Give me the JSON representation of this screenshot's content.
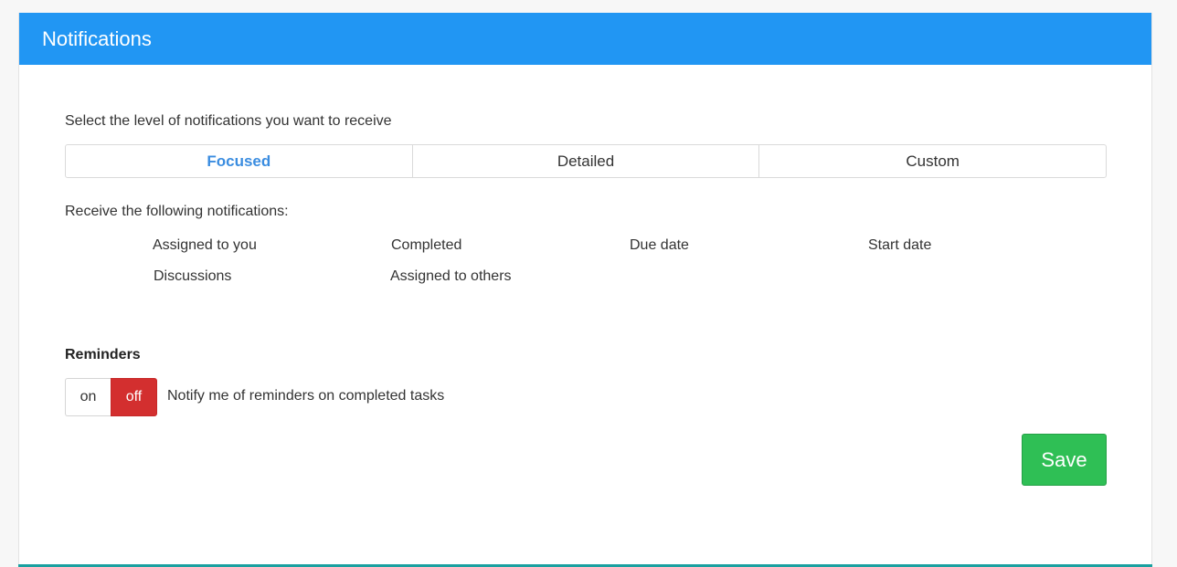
{
  "header": {
    "title": "Notifications"
  },
  "levels": {
    "prompt": "Select the level of notifications you want to receive",
    "options": [
      {
        "label": "Focused",
        "selected": true
      },
      {
        "label": "Detailed",
        "selected": false
      },
      {
        "label": "Custom",
        "selected": false
      }
    ]
  },
  "notifications": {
    "label": "Receive the following notifications:",
    "items": [
      {
        "label": "Assigned to you"
      },
      {
        "label": "Completed"
      },
      {
        "label": "Due date"
      },
      {
        "label": "Start date"
      },
      {
        "label": "Discussions"
      },
      {
        "label": "Assigned to others"
      }
    ]
  },
  "reminders": {
    "title": "Reminders",
    "on_label": "on",
    "off_label": "off",
    "state": "off",
    "description": "Notify me of reminders on completed tasks"
  },
  "actions": {
    "save_label": "Save"
  },
  "colors": {
    "header": "#2196f3",
    "active_option": "#3b8de0",
    "toggle_off": "#d32f2f",
    "save": "#2fbf55"
  }
}
